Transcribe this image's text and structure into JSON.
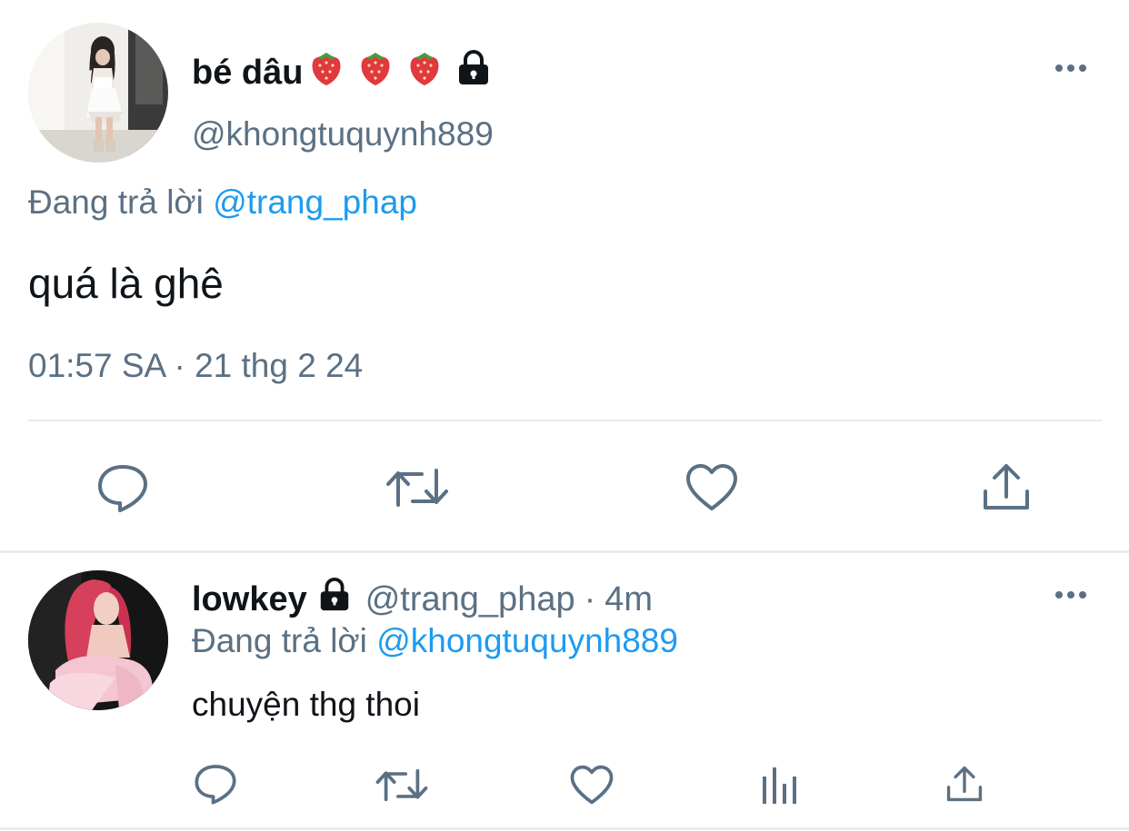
{
  "main_tweet": {
    "display_name": "bé dâu",
    "handle": "@khongtuquynh889",
    "replying_prefix": "Đang trả lời",
    "replying_to": "@trang_phap",
    "text": "quá là ghê",
    "timestamp": "01:57 SA · 21 thg 2 24",
    "icons": [
      "strawberry-emoji",
      "strawberry-emoji",
      "strawberry-emoji",
      "lock-icon",
      "more-icon",
      "reply-icon",
      "retweet-icon",
      "like-icon",
      "share-icon"
    ]
  },
  "reply_tweet": {
    "display_name": "lowkey",
    "handle": "@trang_phap",
    "separator": "·",
    "time_ago": "4m",
    "replying_prefix": "Đang trả lời",
    "replying_to": "@khongtuquynh889",
    "text": "chuyện thg thoi",
    "icons": [
      "lock-icon",
      "more-icon",
      "reply-icon",
      "retweet-icon",
      "like-icon",
      "analytics-icon",
      "share-icon"
    ]
  },
  "colors": {
    "text": "#0f1419",
    "secondary": "#5b7083",
    "link": "#1d9bf0",
    "divider": "#e6ecf0",
    "strawberry": "#e0393e"
  }
}
